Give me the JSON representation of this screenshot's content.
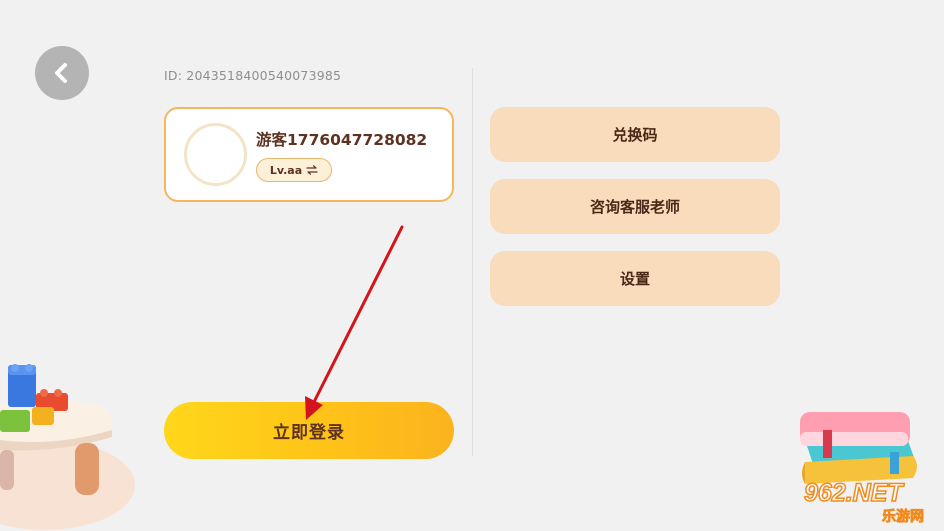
{
  "header": {
    "back_icon": "chevron-left-icon",
    "user_id": "ID: 2043518400540073985"
  },
  "profile": {
    "username": "游客1776047728082",
    "level": "Lv.aa",
    "level_icon": "swap-arrows-icon"
  },
  "menu": {
    "items": [
      {
        "label": "兑换码"
      },
      {
        "label": "咨询客服老师"
      },
      {
        "label": "设置"
      }
    ]
  },
  "login": {
    "label": "立即登录"
  },
  "watermark": {
    "logo_text": "962.NET",
    "site_text": "乐游网"
  },
  "colors": {
    "background": "#f1f1f1",
    "card_border": "#f6b65a",
    "menu_button": "#f9dcbb",
    "login_gradient_start": "#ffd71a",
    "login_gradient_end": "#fcb31e",
    "text_brown": "#5e3220",
    "annotation_arrow": "#d4141c"
  }
}
